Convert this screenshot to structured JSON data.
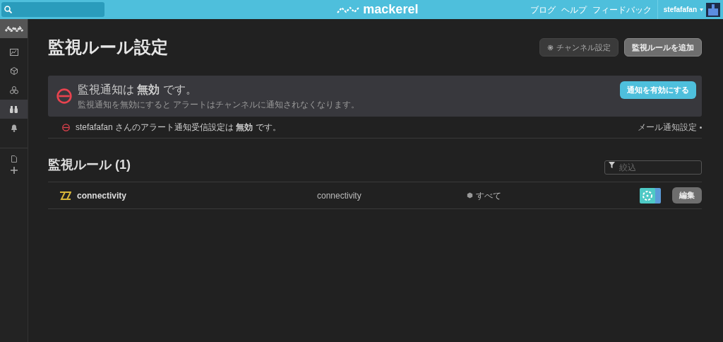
{
  "topbar": {
    "logo": "mackerel",
    "links": [
      "ブログ",
      "ヘルプ",
      "フィードバック"
    ],
    "user": "stefafafan"
  },
  "sidebar": {
    "items": [
      {
        "kind": "graph",
        "selected": false
      },
      {
        "kind": "host",
        "selected": false
      },
      {
        "kind": "services",
        "selected": false
      },
      {
        "kind": "monitors",
        "selected": true
      },
      {
        "kind": "alerts",
        "selected": false
      },
      {
        "kind": "doc",
        "selected": false
      },
      {
        "kind": "add",
        "selected": false
      }
    ]
  },
  "page": {
    "title": "監視ルール設定",
    "buttons": [
      {
        "label": "チャンネル設定",
        "kind": "channels"
      },
      {
        "label": "監視ルールを追加",
        "kind": "add"
      }
    ]
  },
  "alert": {
    "title": "監視通知は **無効** です。",
    "description": "監視通知を無効にすると アラートはチャンネルに通知されなくなります。",
    "button": "通知を有効にする"
  },
  "user_notice": {
    "text": "stefafafan さんのアラート通知受信設定は **無効** です。",
    "link": "メール通知設定"
  },
  "rules": {
    "heading": "監視ルール (1)",
    "filter": {
      "placeholder": "絞込"
    },
    "items": [
      {
        "name": "connectivity",
        "type": "connectivity",
        "scope": "すべて",
        "edit": "編集"
      }
    ]
  }
}
